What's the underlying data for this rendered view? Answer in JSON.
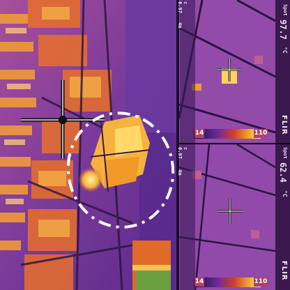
{
  "image": {
    "description_colors": {
      "background_purple": "#7a3a9a",
      "hot_yellow": "#ffe06a",
      "warm_orange": "#f08a2a",
      "cold_dark": "#24143a"
    }
  },
  "left_view": {
    "crosshair_icon": "crosshair-icon",
    "highlight_ellipse_icon": "dashed-ellipse-icon"
  },
  "top_right_panel": {
    "temperature": "97.7",
    "unit": "°C",
    "spot_label": "Spot",
    "small_lines": [
      "c",
      "0.97",
      "4m"
    ],
    "scale_min": "14",
    "scale_max": "110",
    "brand": "FLIR"
  },
  "bottom_right_panel": {
    "temperature": "62.4",
    "unit": "°C",
    "spot_label": "Spot",
    "small_lines": [
      "c",
      "0.97",
      "4m"
    ],
    "scale_min": "14",
    "scale_max": "110",
    "brand": "FLIR"
  }
}
